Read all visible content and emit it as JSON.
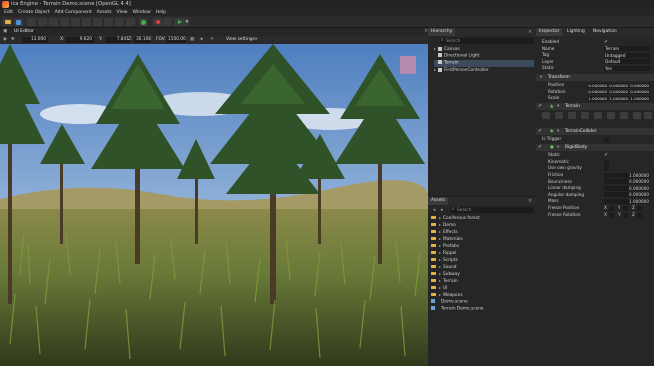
{
  "window": {
    "title": "ica Engine - Terrain Demo.scene [OpenGL 4.4]"
  },
  "menu": [
    "Edit",
    "Create Object",
    "Add Component",
    "Assets",
    "View",
    "Window",
    "Help"
  ],
  "scene": {
    "tab": "UI Editor",
    "move_speed": "13.000",
    "pos_x_label": "X:",
    "pos_x": "9.620",
    "pos_y_label": "Y:",
    "pos_y": "7.841",
    "pos_z_label": "Z:",
    "pos_z": "36.108",
    "fov_label": "FOV:",
    "fov": "1500.00",
    "view_settings": "View settings"
  },
  "hierarchy": {
    "tab": "Hierarchy",
    "search_placeholder": "Search",
    "items": [
      "Canvas",
      "Directional Light",
      "Terrain",
      "FirstPersonController"
    ]
  },
  "assets": {
    "tab": "Assets",
    "search_placeholder": "Search",
    "items": [
      "Coniferous forest",
      "Demo",
      "Effects",
      "Materials",
      "Prefabs",
      "Rippel",
      "Scripts",
      "Sound",
      "Subway",
      "Terrain",
      "UI",
      "Weapons",
      "Demo.scene",
      "Terrain Demo.scene"
    ]
  },
  "inspector": {
    "tabs": [
      "Inspector",
      "Lighting",
      "Navigation"
    ],
    "enabled_label": "Enabled",
    "name_label": "Name",
    "name_value": "Terrain",
    "tag_label": "Tag",
    "tag_value": "Untagged",
    "layer_label": "Layer",
    "layer_value": "Default",
    "static_label": "Static",
    "static_value": "Yes",
    "transform": {
      "header": "Transform",
      "position_label": "Position",
      "position": [
        "0.000000",
        "0.000000",
        "0.000000"
      ],
      "rotation_label": "Rotation",
      "rotation": [
        "0.000000",
        "0.000000",
        "0.000000"
      ],
      "scale_label": "Scale",
      "scale": [
        "1.000000",
        "1.000000",
        "1.000000"
      ]
    },
    "terrain_header": "Terrain",
    "collider_header": "TerrainCollider",
    "is_trigger_label": "Is Trigger",
    "rigidbody": {
      "header": "RigidBody",
      "static_label": "Static",
      "kinematic_label": "Kinematic",
      "gravity_label": "Use own gravity",
      "friction_label": "Friction",
      "friction": "1.000000",
      "bounciness_label": "Bounciness",
      "bounciness": "0.000000",
      "linear_label": "Linear damping",
      "linear": "0.000000",
      "angular_label": "Angular damping",
      "angular": "0.000000",
      "mass_label": "Mass",
      "mass": "1.000000",
      "freeze_pos_label": "Freeze Position",
      "freeze_rot_label": "Freeze Rotation",
      "axes": [
        "X",
        "Y",
        "Z"
      ]
    }
  }
}
